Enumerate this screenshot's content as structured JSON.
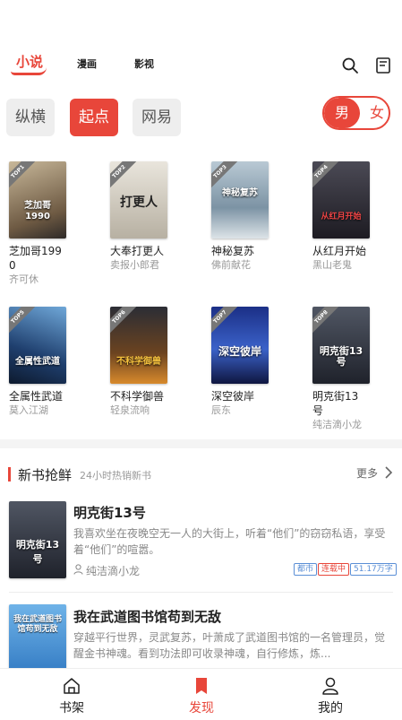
{
  "topnav": {
    "tabs": [
      "小说",
      "漫画",
      "影视"
    ],
    "icons": [
      "search-icon",
      "bookshelf-history-icon"
    ]
  },
  "sources": [
    "纵横",
    "起点",
    "网易"
  ],
  "active_source": "起点",
  "gender": {
    "male": "男",
    "female": "女"
  },
  "ranking": [
    {
      "rank": "TOP1",
      "title": "芝加哥1990",
      "author": "齐可休",
      "cover_text": "芝加哥1990",
      "cover_color": "#8a7a62"
    },
    {
      "rank": "TOP2",
      "title": "大奉打更人",
      "author": "卖报小郎君",
      "cover_text": "打更人",
      "cover_color": "#c9c3b6"
    },
    {
      "rank": "TOP3",
      "title": "神秘复苏",
      "author": "佛前献花",
      "cover_text": "神秘复苏",
      "cover_color": "#9fb3c1"
    },
    {
      "rank": "TOP4",
      "title": "从红月开始",
      "author": "黑山老鬼",
      "cover_text": "从红月开始",
      "cover_color": "#2e2a33"
    },
    {
      "rank": "TOP5",
      "title": "全属性武道",
      "author": "莫入江湖",
      "cover_text": "全属性武道",
      "cover_color": "#2a4c78"
    },
    {
      "rank": "TOP6",
      "title": "不科学御兽",
      "author": "轻泉流响",
      "cover_text": "不科学御兽",
      "cover_color": "#3a2a1c"
    },
    {
      "rank": "TOP7",
      "title": "深空彼岸",
      "author": "辰东",
      "cover_text": "深空彼岸",
      "cover_color": "#243a8a"
    },
    {
      "rank": "TOP8",
      "title": "明克街13号",
      "author": "纯洁滴小龙",
      "cover_text": "明克街13号",
      "cover_color": "#2b2f3a"
    }
  ],
  "section": {
    "title": "新书抢鲜",
    "subtitle": "24小时热销新书",
    "more": "更多"
  },
  "new_books": [
    {
      "title": "明克街13号",
      "desc": "我喜欢坐在夜晚空无一人的大街上，听着“他们”的窃窃私语，享受着“他们”的喧嚣。",
      "author": "纯洁滴小龙",
      "tags": [
        "都市",
        "连载中",
        "51.17万字"
      ],
      "tag_colors": [
        "#5b8fd6",
        "#e8463a",
        "#5b8fd6"
      ],
      "cover_text": "明克街13号",
      "cover_color": "#2b2f3a"
    },
    {
      "title": "我在武道图书馆苟到无敌",
      "desc": "穿越平行世界，灵武复苏，叶萧成了武道图书馆的一名管理员，觉醒金书神魂。看到功法即可收录神魂，自行修炼，炼...",
      "cover_text": "我在武道图书馆苟到无敌",
      "cover_color": "#3d8fd3"
    }
  ],
  "bottombar": {
    "items": [
      "书架",
      "发现",
      "我的"
    ],
    "active": "发现"
  },
  "colors": {
    "accent": "#e8463a",
    "muted": "#999999"
  }
}
